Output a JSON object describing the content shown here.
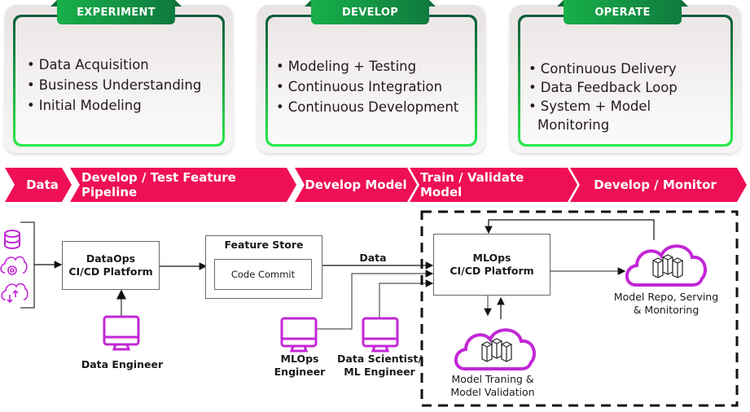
{
  "phases": [
    {
      "title": "EXPERIMENT",
      "items": [
        "Data Acquisition",
        "Business Understanding",
        "Initial Modeling"
      ]
    },
    {
      "title": "DEVELOP",
      "items": [
        "Modeling + Testing",
        "Continuous Integration",
        "Continuous Development"
      ]
    },
    {
      "title": "OPERATE",
      "items": [
        "Continuous Delivery",
        "Data Feedback Loop",
        "System + Model Monitoring"
      ]
    }
  ],
  "pipeline": {
    "color": "#ef0f57",
    "steps": [
      "Data",
      "Develop / Test Feature Pipeline",
      "Develop Model",
      "Train / Validate Model",
      "Develop / Monitor"
    ]
  },
  "diagram": {
    "accent_color": "#c227d6",
    "data_sources": [
      "database-icon",
      "cloud-settings-icon",
      "cloud-sync-icon"
    ],
    "dataops_platform": {
      "line1": "DataOps",
      "line2": "CI/CD Platform"
    },
    "feature_store": {
      "title": "Feature Store",
      "inner": "Code Commit"
    },
    "data_edge_label": "Data",
    "mlops_platform": {
      "line1": "MLOps",
      "line2": "CI/CD Platform"
    },
    "model_repo": {
      "line1": "Model Repo, Serving",
      "line2": "& Monitoring"
    },
    "model_training": {
      "line1": "Model Traning &",
      "line2": "Model Validation"
    },
    "roles": {
      "data_engineer": "Data Engineer",
      "mlops_engineer": {
        "line1": "MLOps",
        "line2": "Engineer"
      },
      "data_scientist": {
        "line1": "Data Scientist/",
        "line2": "ML Engineer"
      }
    }
  }
}
